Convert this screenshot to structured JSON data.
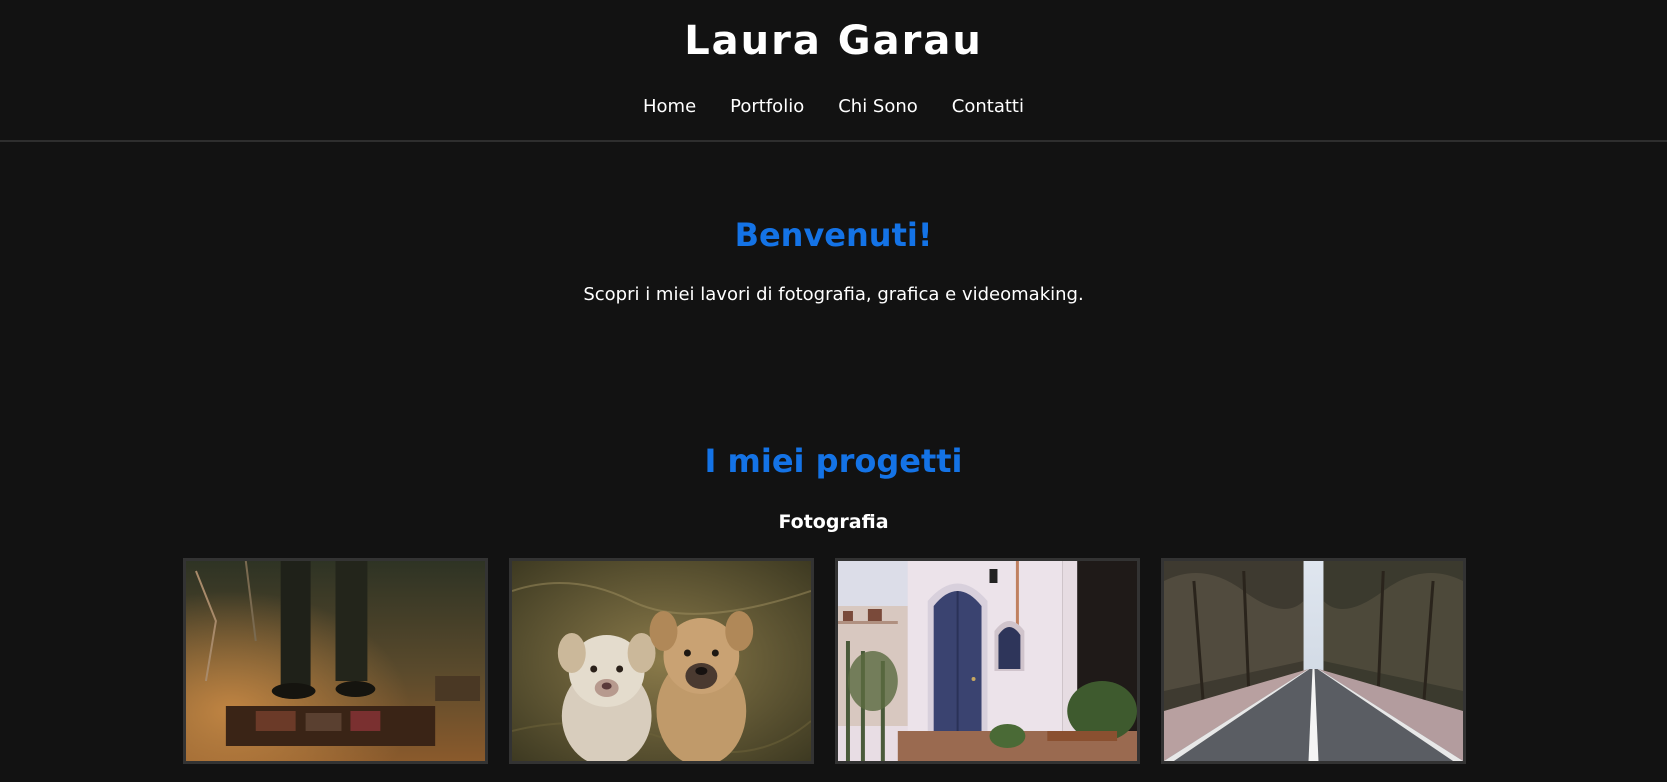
{
  "header": {
    "site_title": "Laura Garau",
    "nav": [
      {
        "label": "Home"
      },
      {
        "label": "Portfolio"
      },
      {
        "label": "Chi Sono"
      },
      {
        "label": "Contatti"
      }
    ]
  },
  "hero": {
    "heading": "Benvenuti!",
    "text": "Scopri i miei lavori di fotografia, grafica e videomaking."
  },
  "projects": {
    "heading": "I miei progetti",
    "category": "Fotografia",
    "photos": [
      {
        "subject": "musician-pedalboard-photo"
      },
      {
        "subject": "two-puppies-photo"
      },
      {
        "subject": "white-house-blue-door-photo"
      },
      {
        "subject": "forest-road-photo"
      }
    ]
  },
  "colors": {
    "background": "#121212",
    "accent": "#1473e6",
    "text": "#ffffff",
    "border": "#333333"
  }
}
